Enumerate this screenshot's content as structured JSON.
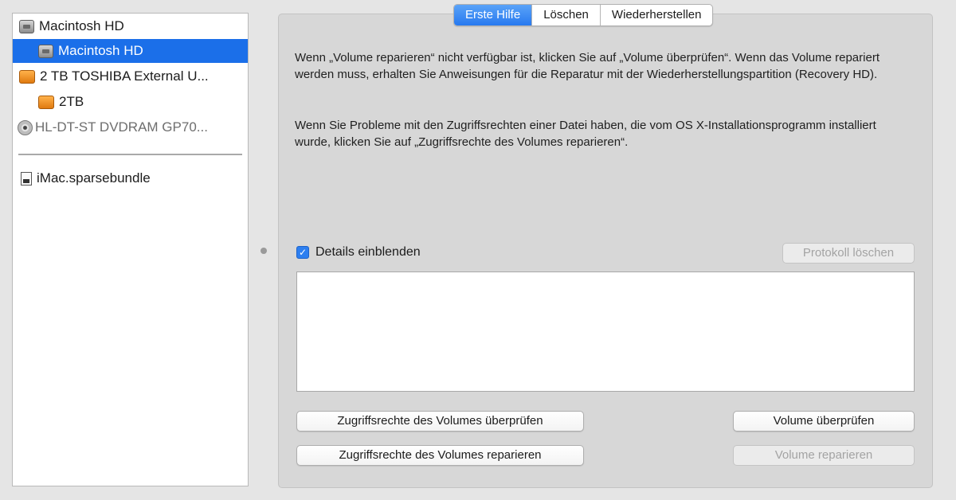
{
  "sidebar": {
    "items": [
      {
        "label": "Macintosh HD",
        "icon": "internal-disk-icon",
        "selected": false
      },
      {
        "label": "Macintosh HD",
        "icon": "volume-icon",
        "selected": true
      },
      {
        "label": "2 TB TOSHIBA External U...",
        "icon": "external-disk-icon",
        "selected": false
      },
      {
        "label": "2TB",
        "icon": "external-volume-icon",
        "selected": false
      },
      {
        "label": "HL-DT-ST DVDRAM GP70...",
        "icon": "optical-drive-icon",
        "selected": false
      },
      {
        "label": "iMac.sparsebundle",
        "icon": "disk-image-icon",
        "selected": false
      }
    ]
  },
  "tabs": [
    {
      "label": "Erste Hilfe",
      "active": true
    },
    {
      "label": "Löschen",
      "active": false
    },
    {
      "label": "Wiederherstellen",
      "active": false
    }
  ],
  "info": {
    "paragraph1": "Wenn „Volume reparieren“ nicht verfügbar ist, klicken Sie auf „Volume überprüfen“. Wenn das Volume repariert werden muss, erhalten Sie Anweisungen für die Reparatur mit der Wiederherstellungspartition (Recovery HD).",
    "paragraph2": "Wenn Sie Probleme mit den Zugriffsrechten einer Datei haben, die vom OS X-Installationsprogramm installiert wurde, klicken Sie auf „Zugriffsrechte des Volumes reparieren“."
  },
  "details": {
    "label": "Details einblenden",
    "checked": true
  },
  "buttons": {
    "clear_log": "Protokoll löschen",
    "verify_permissions": "Zugriffsrechte des Volumes überprüfen",
    "repair_permissions": "Zugriffsrechte des Volumes reparieren",
    "verify_volume": "Volume überprüfen",
    "repair_volume": "Volume reparieren"
  },
  "colors": {
    "selection": "#1b6fe9",
    "active_tab": "#2779ef",
    "panel_background": "#d7d7d7"
  }
}
